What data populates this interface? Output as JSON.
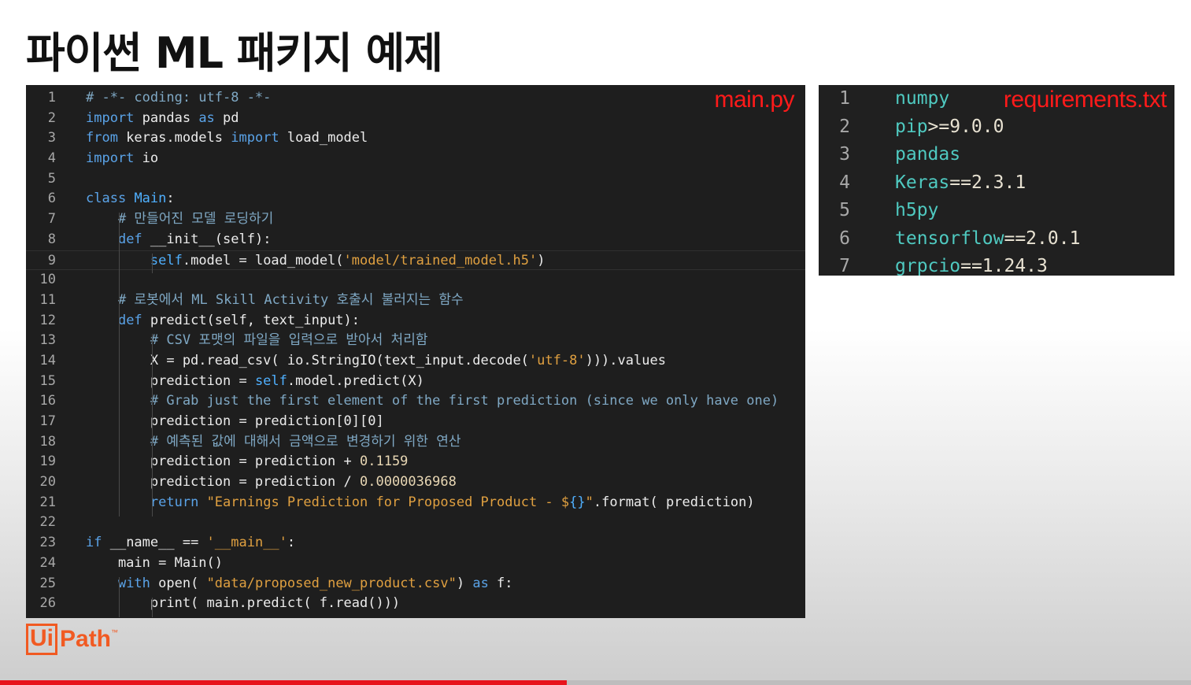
{
  "slide": {
    "title": "파이썬 ML 패키지 예제"
  },
  "code_panel": {
    "file_label": "main.py",
    "lines": [
      {
        "n": "1",
        "tokens": [
          {
            "t": "# -*- coding: utf-8 -*-",
            "c": "cm"
          }
        ]
      },
      {
        "n": "2",
        "tokens": [
          {
            "t": "import",
            "c": "kw"
          },
          {
            "t": " pandas "
          },
          {
            "t": "as",
            "c": "kw"
          },
          {
            "t": " pd"
          }
        ]
      },
      {
        "n": "3",
        "tokens": [
          {
            "t": "from",
            "c": "kw"
          },
          {
            "t": " keras.models "
          },
          {
            "t": "import",
            "c": "kw"
          },
          {
            "t": " load_model"
          }
        ]
      },
      {
        "n": "4",
        "tokens": [
          {
            "t": "import",
            "c": "kw"
          },
          {
            "t": " io"
          }
        ]
      },
      {
        "n": "5",
        "tokens": []
      },
      {
        "n": "6",
        "tokens": [
          {
            "t": "class",
            "c": "kw"
          },
          {
            "t": " "
          },
          {
            "t": "Main",
            "c": "self"
          },
          {
            "t": ":"
          }
        ]
      },
      {
        "n": "7",
        "tokens": [
          {
            "t": "    "
          },
          {
            "t": "# 만들어진 모델 로딩하기",
            "c": "cm"
          }
        ]
      },
      {
        "n": "8",
        "tokens": [
          {
            "t": "    "
          },
          {
            "t": "def",
            "c": "kw"
          },
          {
            "t": " __init__(self):"
          }
        ]
      },
      {
        "n": "9",
        "tokens": [
          {
            "t": "        "
          },
          {
            "t": "self",
            "c": "self"
          },
          {
            "t": ".model = load_model("
          },
          {
            "t": "'model/trained_model.h5'",
            "c": "str"
          },
          {
            "t": ")"
          }
        ],
        "active": true
      },
      {
        "n": "10",
        "tokens": []
      },
      {
        "n": "11",
        "tokens": [
          {
            "t": "    "
          },
          {
            "t": "# 로봇에서 ML Skill Activity 호출시 불러지는 함수",
            "c": "cm"
          }
        ]
      },
      {
        "n": "12",
        "tokens": [
          {
            "t": "    "
          },
          {
            "t": "def",
            "c": "kw"
          },
          {
            "t": " predict(self, text_input):"
          }
        ]
      },
      {
        "n": "13",
        "tokens": [
          {
            "t": "        "
          },
          {
            "t": "# CSV 포맷의 파일을 입력으로 받아서 처리함",
            "c": "cm"
          }
        ]
      },
      {
        "n": "14",
        "tokens": [
          {
            "t": "        X = pd.read_csv( io.StringIO(text_input.decode("
          },
          {
            "t": "'utf-8'",
            "c": "str"
          },
          {
            "t": "))).values"
          }
        ]
      },
      {
        "n": "15",
        "tokens": [
          {
            "t": "        prediction = "
          },
          {
            "t": "self",
            "c": "self"
          },
          {
            "t": ".model.predict(X)"
          }
        ]
      },
      {
        "n": "16",
        "tokens": [
          {
            "t": "        "
          },
          {
            "t": "# Grab just the first element of the first prediction (since we only have one)",
            "c": "cm"
          }
        ]
      },
      {
        "n": "17",
        "tokens": [
          {
            "t": "        prediction = prediction[0][0]"
          }
        ]
      },
      {
        "n": "18",
        "tokens": [
          {
            "t": "        "
          },
          {
            "t": "# 예측된 값에 대해서 금액으로 변경하기 위한 연산",
            "c": "cm"
          }
        ]
      },
      {
        "n": "19",
        "tokens": [
          {
            "t": "        prediction = prediction + "
          },
          {
            "t": "0.1159",
            "c": "num"
          }
        ]
      },
      {
        "n": "20",
        "tokens": [
          {
            "t": "        prediction = prediction / "
          },
          {
            "t": "0.0000036968",
            "c": "num"
          }
        ]
      },
      {
        "n": "21",
        "tokens": [
          {
            "t": "        "
          },
          {
            "t": "return",
            "c": "kw"
          },
          {
            "t": " "
          },
          {
            "t": "\"Earnings Prediction for Proposed Product - $",
            "c": "str"
          },
          {
            "t": "{}",
            "c": "self"
          },
          {
            "t": "\"",
            "c": "str"
          },
          {
            "t": ".format( prediction)"
          }
        ]
      },
      {
        "n": "22",
        "tokens": []
      },
      {
        "n": "23",
        "tokens": [
          {
            "t": "if",
            "c": "kw"
          },
          {
            "t": " __name__ == "
          },
          {
            "t": "'__main__'",
            "c": "str"
          },
          {
            "t": ":"
          }
        ]
      },
      {
        "n": "24",
        "tokens": [
          {
            "t": "    main = Main()"
          }
        ]
      },
      {
        "n": "25",
        "tokens": [
          {
            "t": "    "
          },
          {
            "t": "with",
            "c": "kw"
          },
          {
            "t": " open( "
          },
          {
            "t": "\"data/proposed_new_product.csv\"",
            "c": "str"
          },
          {
            "t": ") "
          },
          {
            "t": "as",
            "c": "kw"
          },
          {
            "t": " f:"
          }
        ]
      },
      {
        "n": "26",
        "tokens": [
          {
            "t": "        print( main.predict( f.read()))"
          }
        ]
      }
    ]
  },
  "requirements_panel": {
    "file_label": "requirements.txt",
    "lines": [
      {
        "n": "1",
        "pkg": "numpy",
        "ver": ""
      },
      {
        "n": "2",
        "pkg": "pip",
        "ver": ">=9.0.0"
      },
      {
        "n": "3",
        "pkg": "pandas",
        "ver": ""
      },
      {
        "n": "4",
        "pkg": "Keras",
        "ver": "==2.3.1"
      },
      {
        "n": "5",
        "pkg": "h5py",
        "ver": ""
      },
      {
        "n": "6",
        "pkg": "tensorflow",
        "ver": "==2.0.1"
      },
      {
        "n": "7",
        "pkg": "grpcio",
        "ver": "==1.24.3"
      }
    ]
  },
  "logo": {
    "box_text": "Ui",
    "rest_text": "Path",
    "tm": "™"
  },
  "progress": {
    "fraction": 0.476
  },
  "colors": {
    "accent_red": "#e8131b",
    "brand_orange": "#f15a22",
    "code_bg": "#1e1e1e"
  }
}
